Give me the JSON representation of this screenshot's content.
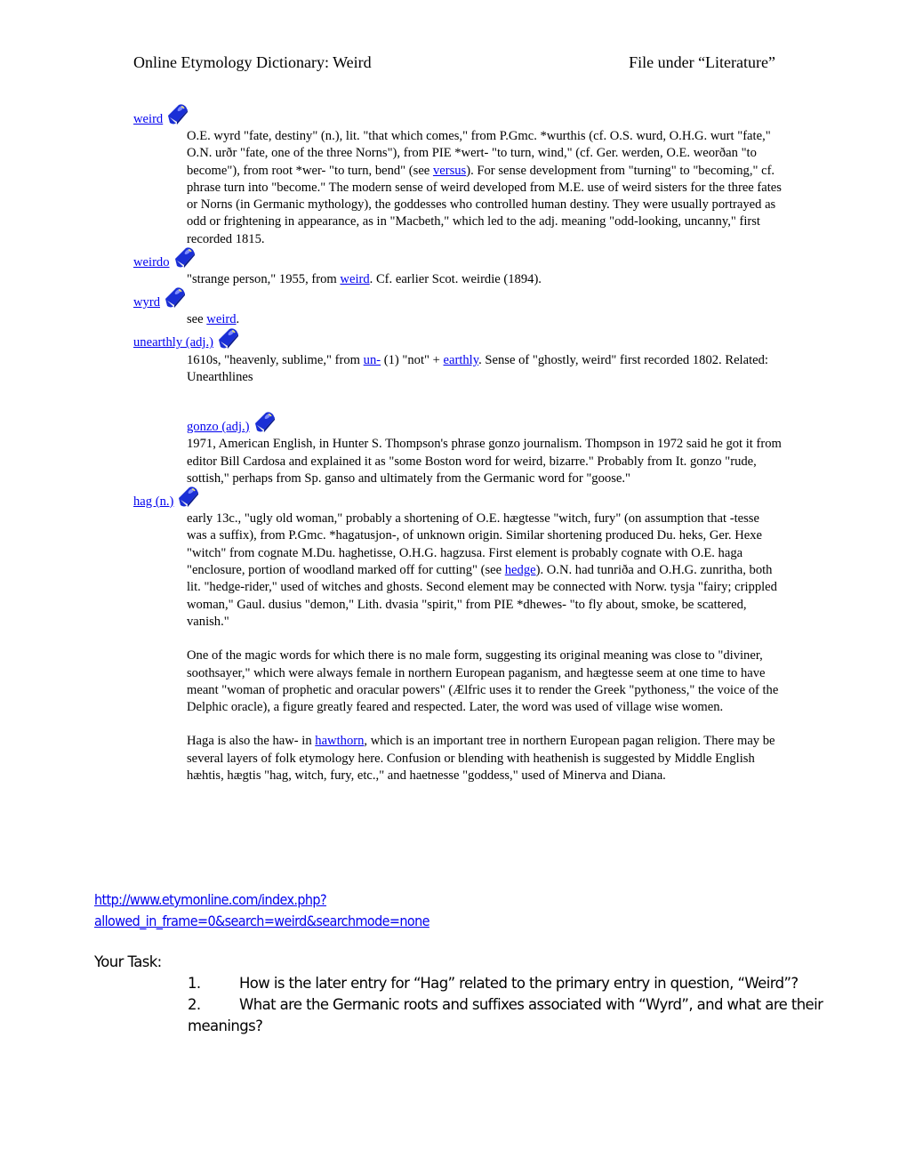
{
  "header": {
    "title": "Online Etymology Dictionary: Weird",
    "filing": "File under “Literature”"
  },
  "icons": {
    "entry_icon": "book-icon"
  },
  "colors": {
    "link": "#0000ee",
    "text": "#000000"
  },
  "entries": [
    {
      "headword": "weird",
      "definition_parts": [
        "O.E. wyrd \"fate, destiny\" (n.), lit. \"that which comes,\" from P.Gmc. *wurthis (cf. O.S. wurd, O.H.G. wurt \"fate,\" O.N. urðr \"fate, one of the three Norns\"), from PIE *wert- \"to turn, wind,\" (cf. Ger. werden, O.E. weorðan \"to become\"), from root *wer- \"to turn, bend\" (see ",
        "versus",
        "). For sense development from \"turning\" to \"becoming,\" cf. phrase turn into \"become.\" The modern sense of weird developed from M.E. use of weird sisters for the three fates or Norns (in Germanic mythology), the goddesses who controlled human destiny. They were usually portrayed as odd or frightening in appearance, as in \"Macbeth,\" which led to the adj. meaning \"odd-looking, uncanny,\" first recorded 1815."
      ]
    },
    {
      "headword": "weirdo",
      "definition_parts": [
        "\"strange person,\" 1955, from ",
        "weird",
        ". Cf. earlier Scot. weirdie (1894)."
      ]
    },
    {
      "headword": "wyrd",
      "definition_parts": [
        "see ",
        "weird",
        "."
      ]
    },
    {
      "headword": "unearthly (adj.)",
      "definition_parts": [
        "1610s, \"heavenly, sublime,\" from ",
        "un-",
        " (1) \"not\" + ",
        "earthly",
        ". Sense of \"ghostly, weird\" first recorded 1802. Related: Unearthlines"
      ]
    },
    {
      "headword": "gonzo (adj.)",
      "definition": "1971, American English, in Hunter S. Thompson's phrase gonzo journalism. Thompson in 1972 said he got it from editor Bill Cardosa and explained it as \"some Boston word for weird, bizarre.\" Probably from It. gonzo \"rude, sottish,\" perhaps from Sp. ganso and ultimately from the Germanic word for \"goose.\""
    },
    {
      "headword": "hag (n.)",
      "paragraph1_parts": [
        "early 13c., \"ugly old woman,\" probably a shortening of O.E. hægtesse \"witch, fury\" (on assumption that -tesse was a suffix), from P.Gmc. *hagatusjon-, of unknown origin. Similar shortening produced Du. heks, Ger. Hexe \"witch\" from cognate M.Du. haghetisse, O.H.G. hagzusa. First element is probably cognate with O.E. haga \"enclosure, portion of woodland marked off for cutting\" (see ",
        "hedge",
        "). O.N. had tunriða and O.H.G. zunritha, both lit. \"hedge-rider,\" used of witches and ghosts. Second element may be connected with Norw. tysja \"fairy; crippled woman,\" Gaul. dusius \"demon,\" Lith. dvasia \"spirit,\" from PIE *dhewes- \"to fly about, smoke, be scattered, vanish.\""
      ],
      "paragraph2": "One of the magic words for which there is no male form, suggesting its original meaning was close to \"diviner, soothsayer,\" which were always female in northern European paganism, and hægtesse seem at one time to have meant \"woman of prophetic and oracular powers\" (Ælfric uses it to render the Greek \"pythoness,\" the voice of the Delphic oracle), a figure greatly feared and respected. Later, the word was used of village wise women.",
      "paragraph3_parts": [
        "Haga is also the haw- in ",
        "hawthorn",
        ", which is an important tree in northern European pagan religion. There may be several layers of folk etymology here. Confusion or blending with heathenish is suggested by Middle English hæhtis, hægtis \"hag, witch, fury, etc.,\" and haetnesse \"goddess,\" used of Minerva and Diana."
      ]
    }
  ],
  "source_url": {
    "line1": "http://www.etymonline.com/index.php?",
    "line2": "allowed_in_frame=0&search=weird&searchmode=none"
  },
  "task": {
    "heading": "Your Task:",
    "items": [
      {
        "number": "1.",
        "text": "How is the later entry for “Hag” related to the primary entry in question, “Weird”?"
      },
      {
        "number": "2.",
        "text": "What are the Germanic roots and suffixes associated with “Wyrd”, and what are their meanings?"
      }
    ]
  }
}
